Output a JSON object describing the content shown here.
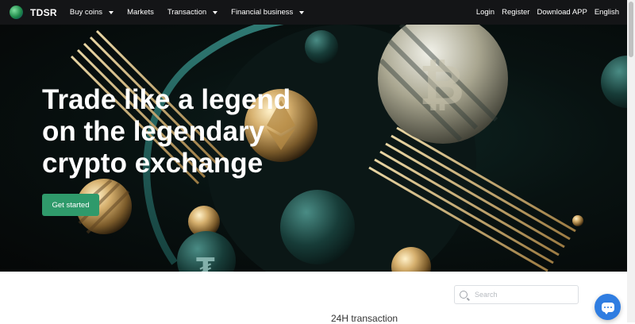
{
  "nav": {
    "brand": "TDSR",
    "items": [
      {
        "label": "Buy coins",
        "dropdown": true
      },
      {
        "label": "Markets",
        "dropdown": false
      },
      {
        "label": "Transaction",
        "dropdown": true
      },
      {
        "label": "Financial business",
        "dropdown": true
      }
    ],
    "right": {
      "login": "Login",
      "register": "Register",
      "download": "Download APP",
      "language": "English"
    }
  },
  "hero": {
    "headline_line1": "Trade like a legend",
    "headline_line2": "on the legendary",
    "headline_line3": "crypto exchange",
    "cta": "Get started",
    "accent_color": "#2f9a6b"
  },
  "markets": {
    "search_placeholder": "Search",
    "column_headers": [
      "24H transaction"
    ]
  },
  "icons": [
    "globe-logo-icon",
    "chevron-down-icon",
    "search-icon",
    "chat-icon"
  ]
}
